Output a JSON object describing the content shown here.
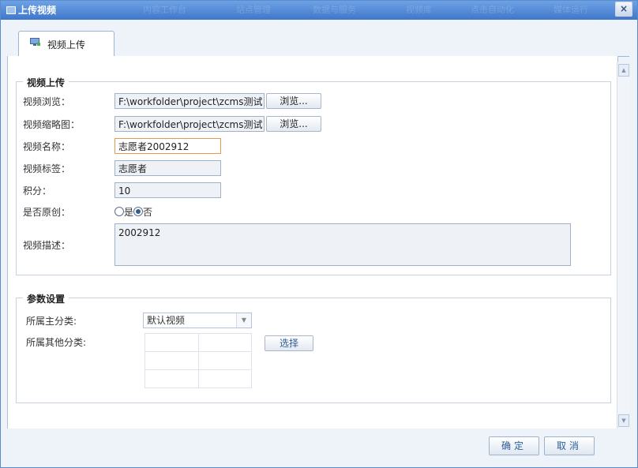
{
  "window": {
    "title": "上传视频",
    "close_label": "×",
    "background_tabs": [
      "内容工作台",
      "站点管理",
      "数据与服务",
      "视频库",
      "点击自动化",
      "媒体运行"
    ]
  },
  "tabs": [
    {
      "label": "视频上传",
      "icon": "monitor-upload-icon"
    }
  ],
  "upload_section": {
    "legend": "视频上传",
    "browse_video": {
      "label": "视频浏览：",
      "value": "F:\\workfolder\\project\\zcms测试",
      "button": "浏览..."
    },
    "browse_thumbnail": {
      "label": "视频缩略图：",
      "value": "F:\\workfolder\\project\\zcms测试",
      "button": "浏览..."
    },
    "name": {
      "label": "视频名称：",
      "value": "志愿者2002912"
    },
    "tags": {
      "label": "视频标签：",
      "value": "志愿者"
    },
    "points": {
      "label": "积分：",
      "value": "10"
    },
    "original": {
      "label": "是否原创：",
      "options": [
        {
          "label": "是",
          "checked": false
        },
        {
          "label": "否",
          "checked": true
        }
      ]
    },
    "description": {
      "label": "视频描述：",
      "value": "2002912"
    }
  },
  "params_section": {
    "legend": "参数设置",
    "main_category": {
      "label": "所属主分类:",
      "value": "默认视频"
    },
    "other_category": {
      "label": "所属其他分类:",
      "button": "选择"
    }
  },
  "footer": {
    "ok_label": "确定",
    "cancel_label": "取消"
  }
}
